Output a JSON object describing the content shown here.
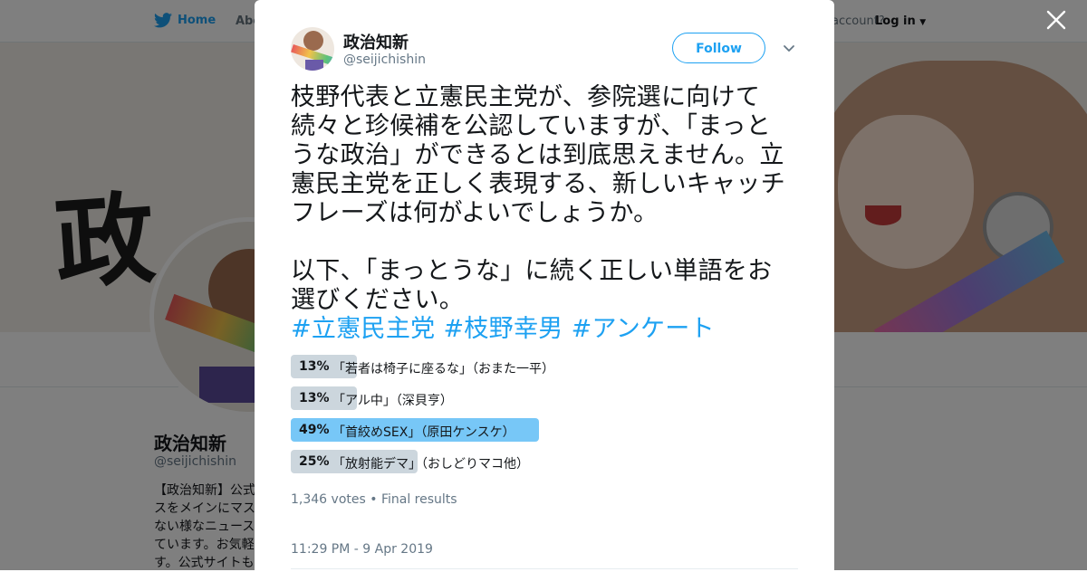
{
  "background_page": {
    "nav": {
      "home": "Home",
      "about": "Abo",
      "account_prompt": "account?",
      "login": "Log in"
    },
    "banner_text": "政",
    "profile": {
      "name": "政治知新",
      "handle": "@seijichishin",
      "bio_lines": [
        "【政治知新】公式",
        "スをメインにマス",
        "ない様なニュース",
        "ています。お気軽",
        "す。公式サイトも"
      ]
    }
  },
  "modal": {
    "close_icon": "close-icon",
    "author": {
      "name": "政治知新",
      "handle": "@seijichishin"
    },
    "follow_label": "Follow",
    "tweet_lines": [
      "枝野代表と立憲民主党が、参院選に向けて",
      "続々と珍候補を公認していますが、「まっと",
      "うな政治」ができるとは到底思えません。立",
      "憲民主党を正しく表現する、新しいキャッチ",
      "フレーズは何がよいでしょうか。"
    ],
    "tweet_lines_2": [
      "以下、「まっとうな」に続く正しい単語をお",
      "選びください。"
    ],
    "hashtags": [
      "#立憲民主党",
      "#枝野幸男",
      "#アンケート"
    ],
    "poll": {
      "options": [
        {
          "percent": 13,
          "percent_label": "13%",
          "label": "「若者は椅子に座るな」（おまた一平）"
        },
        {
          "percent": 13,
          "percent_label": "13%",
          "label": "「アル中」（深貝亨）"
        },
        {
          "percent": 49,
          "percent_label": "49%",
          "label": "「首絞めSEX」（原田ケンスケ）",
          "winner": true
        },
        {
          "percent": 25,
          "percent_label": "25%",
          "label": "「放射能デマ」（おしどりマコ他）"
        }
      ],
      "votes": "1,346 votes",
      "separator": "•",
      "status": "Final results"
    },
    "timestamp": "11:29 PM - 9 Apr 2019"
  },
  "colors": {
    "accent": "#1da1f2",
    "poll_bar": "#ccd6dd",
    "poll_winner": "#77c7f7",
    "text": "#14171a",
    "muted": "#657786"
  }
}
